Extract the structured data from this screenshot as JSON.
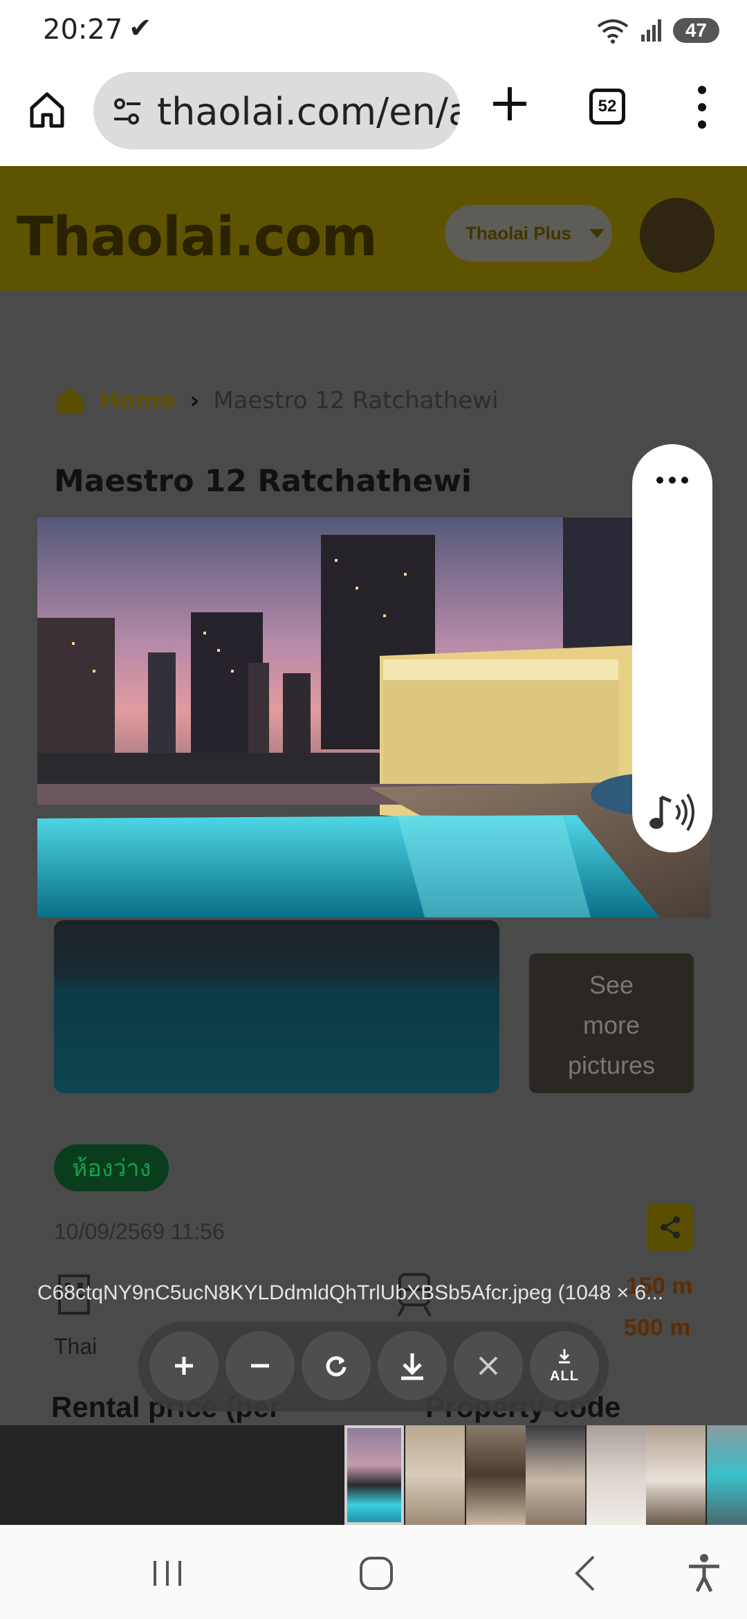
{
  "status": {
    "time": "20:27",
    "notification_icon": "check-download-icon",
    "battery": "47"
  },
  "browser": {
    "url": "thaolai.com/en/a",
    "tab_count": "52"
  },
  "site": {
    "logo": "Thaolai.com",
    "plus_dropdown": "Thaolai Plus",
    "breadcrumb": {
      "home": "Home",
      "current": "Maestro 12 Ratchathewi"
    },
    "title": "Maestro 12 Ratchathewi",
    "see_more": [
      "See",
      "more",
      "pictures"
    ],
    "badge": "ห้องว่าง",
    "date": "10/09/2569 11:56",
    "distance_1": "150 m",
    "distance_2": "500 m",
    "language": "Thai",
    "section_rental": "Rental price (per",
    "section_code": "Property code"
  },
  "viewer": {
    "file_name": "C68ctqNY9nC5ucN8KYLDdmldQhTrlUbXBSb5Afcr.jpeg (1048 × 6...",
    "controls": [
      "zoom-in",
      "zoom-out",
      "rotate",
      "download",
      "close",
      "download-all"
    ],
    "download_all_label": "ALL",
    "thumbnail_count": 7
  },
  "colors": {
    "accent": "#ffd800",
    "badge_green": "#13a04a",
    "overlay_dark": "#4a4a4a"
  }
}
